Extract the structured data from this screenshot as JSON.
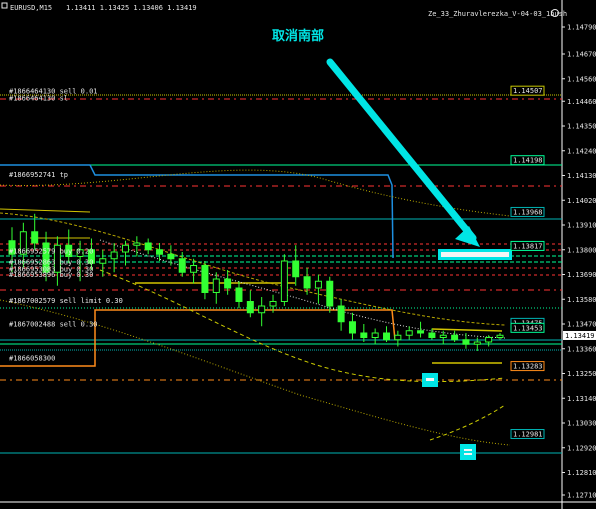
{
  "header": {
    "symbol": "EURUSD,M15",
    "ohlc": "1.13411 1.13425 1.13406 1.13419",
    "ea_name": "Ze_33_Zhuravlerezka_V-04-03_1bush"
  },
  "annotation": {
    "text": "取消南部"
  },
  "chart_data": {
    "type": "candlestick",
    "title": "",
    "y_ticks": [
      1.1479,
      1.1467,
      1.1456,
      1.1446,
      1.1435,
      1.1424,
      1.1413,
      1.1402,
      1.1391,
      1.138,
      1.1369,
      1.1358,
      1.1347,
      1.1336,
      1.1325,
      1.1314,
      1.1303,
      1.1292,
      1.1281,
      1.1271
    ],
    "ylim": [
      1.1271,
      1.1479
    ],
    "current_price": 1.13419,
    "price_labels": [
      {
        "value": 1.14507,
        "text": "1.14507",
        "color": "#c8c800"
      },
      {
        "value": 1.14198,
        "text": "1.14198",
        "color": "#00ff99"
      },
      {
        "value": 1.13968,
        "text": "1.13968",
        "color": "#00b4b4"
      },
      {
        "value": 1.13817,
        "text": "1.13817",
        "color": "#00ff99"
      },
      {
        "value": 1.13475,
        "text": "1.13475",
        "color": "#00b4b4"
      },
      {
        "value": 1.13453,
        "text": "1.13453",
        "color": "#00ff99"
      },
      {
        "value": 1.13283,
        "text": "1.13283",
        "color": "#ff8c1a"
      },
      {
        "value": 1.12981,
        "text": "1.12981",
        "color": "#00b4b4"
      }
    ],
    "order_labels": [
      {
        "text": "#1866464130 sell 0.01",
        "price": 1.14505
      },
      {
        "text": "#1866464130 sl",
        "price": 1.14475
      },
      {
        "text": "#1866952741 tp",
        "price": 1.14135
      },
      {
        "text": "#1866952579 buy 0.20",
        "price": 1.13795
      },
      {
        "text": "#1866952863 buy 0.30",
        "price": 1.13745
      },
      {
        "text": "#1866953083 buy 0.30",
        "price": 1.13715
      },
      {
        "text": "#1866953896 buy 0.30",
        "price": 1.1369
      },
      {
        "text": "#1867002579 sell limit 0.30",
        "price": 1.13575
      },
      {
        "text": "#1867002488 sell 0.30",
        "price": 1.1347
      },
      {
        "text": "#1866058300",
        "price": 1.1332
      }
    ],
    "candles": [
      [
        1.1384,
        1.139,
        1.137,
        1.1378
      ],
      [
        1.1378,
        1.1392,
        1.1372,
        1.1388
      ],
      [
        1.1388,
        1.1396,
        1.138,
        1.1383
      ],
      [
        1.1383,
        1.1388,
        1.1366,
        1.137
      ],
      [
        1.137,
        1.1386,
        1.1364,
        1.1382
      ],
      [
        1.1382,
        1.1389,
        1.1374,
        1.1377
      ],
      [
        1.1377,
        1.1384,
        1.1366,
        1.138
      ],
      [
        1.138,
        1.1385,
        1.1371,
        1.1374
      ],
      [
        1.1374,
        1.138,
        1.1368,
        1.1376
      ],
      [
        1.1376,
        1.1383,
        1.137,
        1.1379
      ],
      [
        1.1379,
        1.1384,
        1.1373,
        1.1382
      ],
      [
        1.1382,
        1.1386,
        1.1377,
        1.1383
      ],
      [
        1.1383,
        1.1385,
        1.1378,
        1.138
      ],
      [
        1.138,
        1.1383,
        1.1375,
        1.1378
      ],
      [
        1.1378,
        1.1382,
        1.1373,
        1.1376
      ],
      [
        1.1376,
        1.1379,
        1.1368,
        1.137
      ],
      [
        1.137,
        1.1376,
        1.1365,
        1.1373
      ],
      [
        1.1373,
        1.1375,
        1.1358,
        1.1361
      ],
      [
        1.1361,
        1.137,
        1.1356,
        1.1367
      ],
      [
        1.1367,
        1.1371,
        1.136,
        1.1363
      ],
      [
        1.1363,
        1.1366,
        1.1354,
        1.1357
      ],
      [
        1.1357,
        1.1362,
        1.135,
        1.1352
      ],
      [
        1.1352,
        1.1359,
        1.1346,
        1.1355
      ],
      [
        1.1355,
        1.136,
        1.1352,
        1.1357
      ],
      [
        1.1357,
        1.1378,
        1.1355,
        1.1375
      ],
      [
        1.1375,
        1.1382,
        1.1364,
        1.1368
      ],
      [
        1.1368,
        1.1372,
        1.136,
        1.1363
      ],
      [
        1.1363,
        1.1369,
        1.1356,
        1.1366
      ],
      [
        1.1366,
        1.1368,
        1.1352,
        1.1355
      ],
      [
        1.1355,
        1.1358,
        1.1344,
        1.1348
      ],
      [
        1.1348,
        1.1352,
        1.134,
        1.1343
      ],
      [
        1.1343,
        1.1347,
        1.1339,
        1.1341
      ],
      [
        1.1341,
        1.1345,
        1.1338,
        1.1343
      ],
      [
        1.1343,
        1.1346,
        1.1339,
        1.134
      ],
      [
        1.134,
        1.1344,
        1.1337,
        1.1342
      ],
      [
        1.1342,
        1.1346,
        1.134,
        1.1344
      ],
      [
        1.1344,
        1.1348,
        1.1341,
        1.1343
      ],
      [
        1.1343,
        1.1345,
        1.134,
        1.1341
      ],
      [
        1.1341,
        1.1344,
        1.1338,
        1.1342
      ],
      [
        1.1342,
        1.1344,
        1.1339,
        1.134
      ],
      [
        1.134,
        1.1343,
        1.1336,
        1.1338
      ],
      [
        1.1338,
        1.1341,
        1.1335,
        1.1339
      ],
      [
        1.1339,
        1.1342,
        1.1337,
        1.1341
      ],
      [
        1.1341,
        1.1343,
        1.134,
        1.1342
      ]
    ]
  }
}
